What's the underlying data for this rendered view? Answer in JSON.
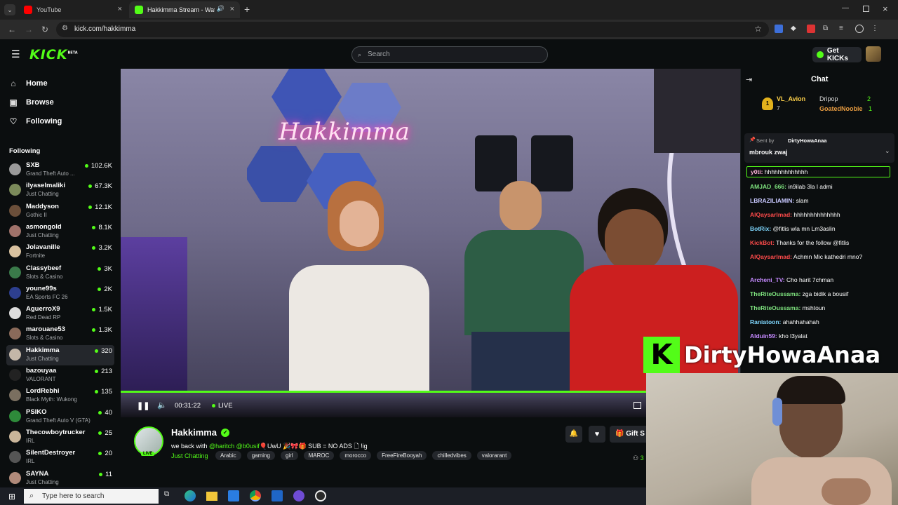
{
  "browser": {
    "tabs": [
      {
        "title": "YouTube",
        "active": false
      },
      {
        "title": "Hakkimma Stream - Watch",
        "active": true
      }
    ],
    "url": "kick.com/hakkimma"
  },
  "header": {
    "logo": "KICK",
    "logo_badge": "BETA",
    "search_placeholder": "Search",
    "get_kicks_label": "Get KICKs"
  },
  "nav": {
    "items": [
      {
        "label": "Home",
        "icon": "home-icon"
      },
      {
        "label": "Browse",
        "icon": "browse-icon"
      },
      {
        "label": "Following",
        "icon": "heart-icon"
      }
    ],
    "following_heading": "Following"
  },
  "following": [
    {
      "name": "SXB",
      "game": "Grand Theft Auto ...",
      "viewers": "102.6K",
      "color": "#9a9a9a"
    },
    {
      "name": "ilyaselmaliki",
      "game": "Just Chatting",
      "viewers": "67.3K",
      "color": "#7b8a5a"
    },
    {
      "name": "Maddyson",
      "game": "Gothic II",
      "viewers": "12.1K",
      "color": "#6b4f3a"
    },
    {
      "name": "asmongold",
      "game": "Just Chatting",
      "viewers": "8.1K",
      "color": "#a0726a"
    },
    {
      "name": "Jolavanille",
      "game": "Fortnite",
      "viewers": "3.2K",
      "color": "#d9c2a0"
    },
    {
      "name": "Classybeef",
      "game": "Slots & Casino",
      "viewers": "3K",
      "color": "#3a7a4a"
    },
    {
      "name": "youne99s",
      "game": "EA Sports FC 26",
      "viewers": "2K",
      "color": "#2d3f8f"
    },
    {
      "name": "AguerroX9",
      "game": "Red Dead RP",
      "viewers": "1.5K",
      "color": "#dddddd"
    },
    {
      "name": "marouane53",
      "game": "Slots & Casino",
      "viewers": "1.3K",
      "color": "#8a6a5a"
    },
    {
      "name": "Hakkimma",
      "game": "Just Chatting",
      "viewers": "320",
      "color": "#c4b7a8",
      "active": true
    },
    {
      "name": "bazouyaa",
      "game": "VALORANT",
      "viewers": "213",
      "color": "#222222"
    },
    {
      "name": "LordRebhi",
      "game": "Black Myth: Wukong",
      "viewers": "135",
      "color": "#7a6f60"
    },
    {
      "name": "PSIKO",
      "game": "Grand Theft Auto V (GTA)",
      "viewers": "40",
      "color": "#2e8a3a"
    },
    {
      "name": "Thecowboytrucker",
      "game": "IRL",
      "viewers": "25",
      "color": "#c9b59a"
    },
    {
      "name": "SilentDestroyer",
      "game": "IRL",
      "viewers": "20",
      "color": "#555555"
    },
    {
      "name": "SAYNA",
      "game": "Just Chatting",
      "viewers": "11",
      "color": "#b08a7a"
    }
  ],
  "video": {
    "neon_text": "Hakkimma",
    "time": "00:31:22",
    "live_label": "LIVE",
    "progress_fraction": 0.85
  },
  "stream": {
    "name": "Hakkimma",
    "live_badge": "LIVE",
    "title_pre": "we back with ",
    "title_mentions": "@haritch @b0usif",
    "title_post": "🎈UwU 🎉🎀🎁 SUB = NO ADS 🗋 !ig",
    "category": "Just Chatting",
    "tags": [
      "Arabic",
      "gaming",
      "girl",
      "MAROC",
      "morocco",
      "FreeFireBooyah",
      "chilledvibes",
      "valorarant"
    ],
    "gift_label": "Gift S",
    "viewer_fragment": "3"
  },
  "chat": {
    "title": "Chat",
    "leaderboard": [
      {
        "rank": "1",
        "name": "VL_Avion",
        "count": "7"
      },
      {
        "name": "Dripop",
        "count": "2"
      },
      {
        "name": "GoatedNoobie",
        "count": "1"
      }
    ],
    "pinned": {
      "sent_by_label": "Sent by",
      "sender": "DirtyHowaAnaa",
      "message": "mbrouk zwaj"
    },
    "messages": [
      {
        "user": "y0ti:",
        "text": "hhhhhhhhhhhhh",
        "color": "#ffb3d9"
      },
      {
        "user": "AMJAD_666:",
        "text": "in9ilab 3la l admi",
        "color": "#7ee27e"
      },
      {
        "user": "LBRAZILIAMIN:",
        "text": "slam",
        "color": "#c8c8ff"
      },
      {
        "user": "AlQaysarlmad:",
        "text": "hhhhhhhhhhhhhh",
        "color": "#ff4b4b"
      },
      {
        "user": "BotRix:",
        "text": "@fitlis wla mn Lm3aslin",
        "color": "#7fd8ff"
      },
      {
        "user": "KickBot:",
        "text": "Thanks for the follow @fitlis",
        "color": "#ff4b4b"
      },
      {
        "user": "AlQaysarlmad:",
        "text": "Achmn Mic kathedri mno?",
        "color": "#ff4b4b"
      },
      {
        "user": "Archeni_TV:",
        "text": "Cho harit 7chman",
        "color": "#c58aff"
      },
      {
        "user": "TheRiteOussama:",
        "text": "zga bidik a bousif",
        "color": "#7ee27e"
      },
      {
        "user": "TheRiteOussama:",
        "text": "mshtoun",
        "color": "#7ee27e"
      },
      {
        "user": "Raniatoon:",
        "text": "ahahhahahah",
        "color": "#7fd8ff"
      },
      {
        "user": "Alduin59:",
        "text": "kho l3yalat",
        "color": "#c58aff"
      }
    ]
  },
  "overlay": {
    "logo_letter": "K",
    "streamer_name": "DirtyHowaAnaa"
  },
  "taskbar": {
    "search_placeholder": "Type here to search"
  }
}
